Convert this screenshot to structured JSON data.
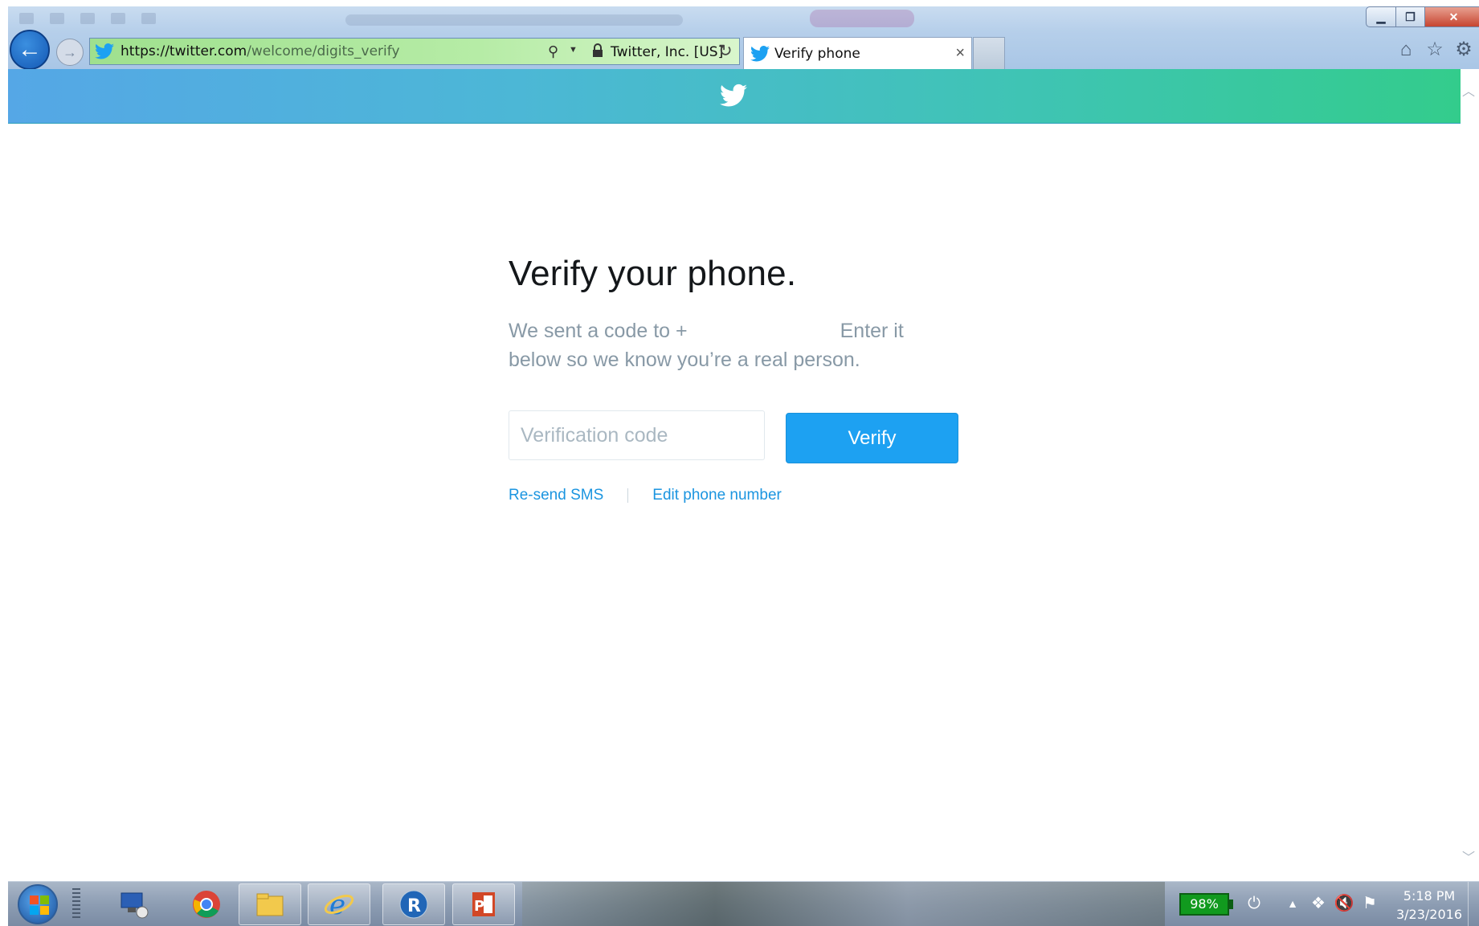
{
  "browser": {
    "address": {
      "url_host": "https://twitter.com",
      "url_path": "/welcome/digits_verify",
      "cert_label": "Twitter, Inc. [US]"
    },
    "tab": {
      "label": "Verify phone",
      "close_glyph": "×"
    },
    "icons": [
      "back-icon",
      "forward-icon",
      "search-icon",
      "lock-icon",
      "refresh-icon",
      "home-icon",
      "favorites-star-icon",
      "settings-gear-icon"
    ]
  },
  "page": {
    "heading": "Verify your phone.",
    "description_start": "We sent a code to +",
    "description_end": "Enter it below so we know you’re a real person.",
    "code_input": {
      "placeholder": "Verification code",
      "value": ""
    },
    "verify_label": "Verify",
    "resend_label": "Re-send SMS",
    "edit_label": "Edit phone number"
  },
  "taskbar": {
    "apps": [
      "remote-desktop",
      "chrome",
      "file-explorer",
      "internet-explorer",
      "r-language",
      "powerpoint"
    ],
    "battery": "98%",
    "time": "5:18 PM",
    "date": "3/23/2016"
  },
  "colors": {
    "twitter_blue": "#1da1f2",
    "link_blue": "#1b95e0",
    "heading_text": "#14171a",
    "muted_text": "#8899a6",
    "banner_start": "#55a7e6",
    "banner_end": "#33cc8c"
  }
}
